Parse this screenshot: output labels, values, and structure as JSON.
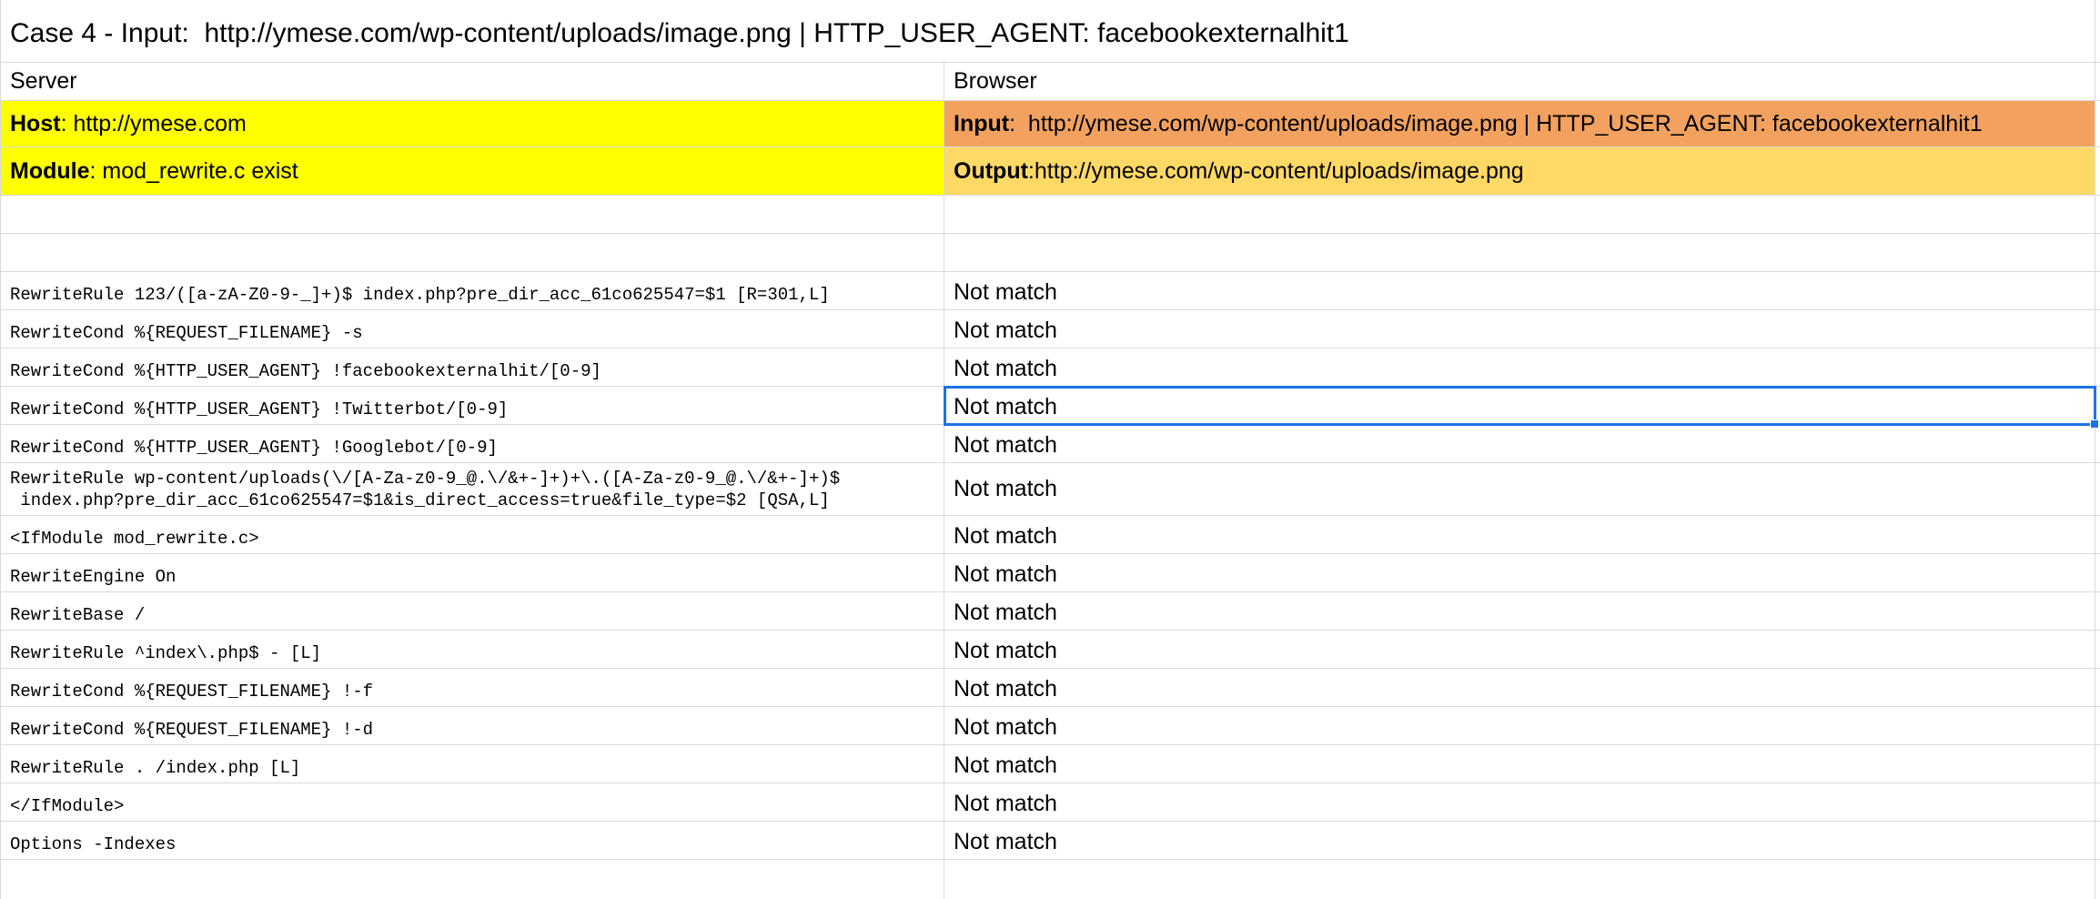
{
  "title": "Case 4 - Input:  http://ymese.com/wp-content/uploads/image.png | HTTP_USER_AGENT: facebookexternalhit1",
  "headers": {
    "server": "Server",
    "browser": "Browser"
  },
  "info": {
    "host_label": "Host",
    "host_value": ": http://ymese.com",
    "module_label": "Module",
    "module_value": ": mod_rewrite.c exist",
    "input_label": "Input",
    "input_value": ":  http://ymese.com/wp-content/uploads/image.png | HTTP_USER_AGENT: facebookexternalhit1",
    "output_label": "Output",
    "output_value": ":http://ymese.com/wp-content/uploads/image.png"
  },
  "rules": [
    {
      "rule": "RewriteRule 123/([a-zA-Z0-9-_]+)$ index.php?pre_dir_acc_61co625547=$1 [R=301,L]",
      "result": "Not match"
    },
    {
      "rule": "RewriteCond %{REQUEST_FILENAME} -s",
      "result": "Not match"
    },
    {
      "rule": "RewriteCond %{HTTP_USER_AGENT} !facebookexternalhit/[0-9]",
      "result": "Not match"
    },
    {
      "rule": "RewriteCond %{HTTP_USER_AGENT} !Twitterbot/[0-9]",
      "result": "Not match"
    },
    {
      "rule": "RewriteCond %{HTTP_USER_AGENT} !Googlebot/[0-9]",
      "result": "Not match"
    },
    {
      "rule": "RewriteRule wp-content/uploads(\\/[A-Za-z0-9_@.\\/&+-]+)+\\.([A-Za-z0-9_@.\\/&+-]+)$",
      "rule2": " index.php?pre_dir_acc_61co625547=$1&is_direct_access=true&file_type=$2 [QSA,L]",
      "result": "Not match"
    },
    {
      "rule": "<IfModule mod_rewrite.c>",
      "result": "Not match"
    },
    {
      "rule": "RewriteEngine On",
      "result": "Not match"
    },
    {
      "rule": "RewriteBase /",
      "result": "Not match"
    },
    {
      "rule": "RewriteRule ^index\\.php$ - [L]",
      "result": "Not match"
    },
    {
      "rule": "RewriteCond %{REQUEST_FILENAME} !-f",
      "result": "Not match"
    },
    {
      "rule": "RewriteCond %{REQUEST_FILENAME} !-d",
      "result": "Not match"
    },
    {
      "rule": "RewriteRule . /index.php [L]",
      "result": "Not match"
    },
    {
      "rule": "</IfModule>",
      "result": "Not match"
    },
    {
      "rule": "Options -Indexes",
      "result": "Not match"
    }
  ],
  "colors": {
    "yellow": "#ffff00",
    "orange": "#f2a25e",
    "light_orange": "#ffd966",
    "selection": "#1a73e8",
    "gridline": "#d9d9d9"
  }
}
